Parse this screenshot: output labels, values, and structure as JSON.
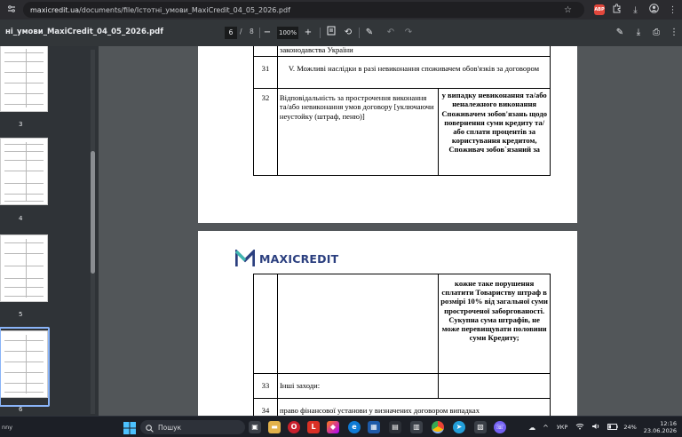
{
  "browser": {
    "url_host": "maxicredit.ua",
    "url_path": "/documents/file/Істотні_умови_MaxiCredit_04_05_2026.pdf",
    "adblock_badge": "ABP"
  },
  "pdf_toolbar": {
    "title": "ні_умови_MaxiCredit_04_05_2026.pdf",
    "current_page": "6",
    "page_separator": "/",
    "total_pages": "8",
    "zoom": "100%"
  },
  "sidebar": {
    "thumbnails": [
      {
        "label": "3"
      },
      {
        "label": "4"
      },
      {
        "label": "5"
      },
      {
        "label": "6"
      }
    ]
  },
  "document": {
    "page1": {
      "row_top_text": "законодавства України",
      "section_num": "31",
      "section_title": "V. Можливі наслідки в разі невиконання споживачем обов'язків за договором",
      "row32_num": "32",
      "row32_left": "Відповідальність за прострочення виконання та/або невиконання умов договору [уключаючи неустойку (штраф, пеню)]",
      "row32_right": "у випадку невиконання та/або неналежного виконання Споживачем зобов'язань щодо повернення суми кредиту та/або сплати процентів за користування кредитом, Споживач зобов`язаний за"
    },
    "page2": {
      "logo_text": "MAXICREDIT",
      "row_cont_right": "кожне таке порушення сплатити Товариству штраф в розмірі 10% від загальної суми простроченої заборгованості. Сукупна сума штрафів, не може перевищувати половини суми Кредиту;",
      "row33_num": "33",
      "row33_left": "Інші заходи:",
      "row34_num": "34",
      "row34_left": "право фінансової установи у визначених договором випадках"
    }
  },
  "taskbar": {
    "left_text": "nny",
    "search_placeholder": "Пошук",
    "language": "УКР",
    "battery": "24%",
    "time": "12:16",
    "date": "23.06.2026"
  },
  "colors": {
    "logo_blue": "#2b3f7f",
    "pdf_toolbar_bg": "#323639",
    "doc_bg": "#525659",
    "selected_thumb": "#8ab4f8"
  }
}
